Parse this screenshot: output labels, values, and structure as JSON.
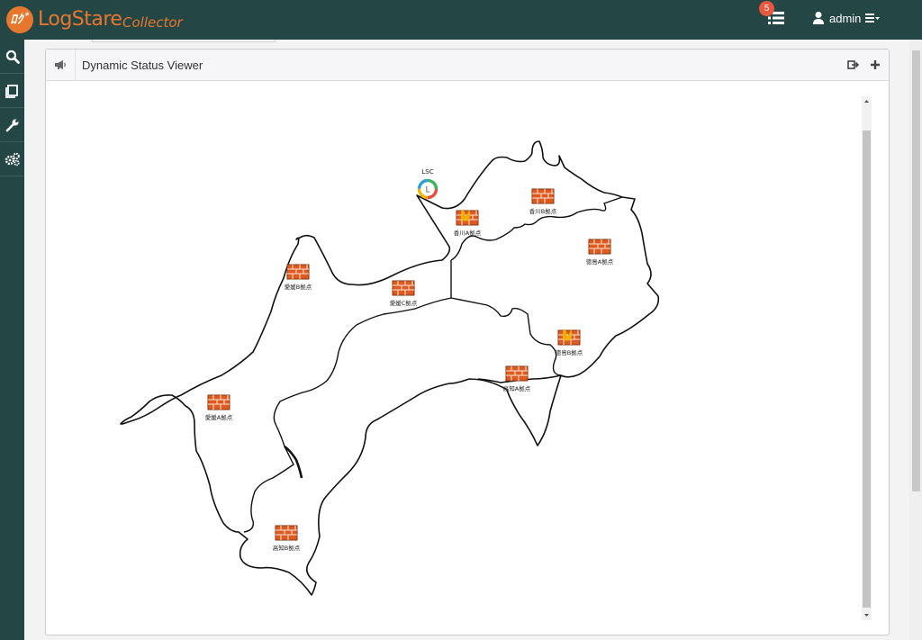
{
  "app": {
    "logo_mark": "ﾛｸﾞ",
    "name": "LogStare",
    "subtitle": "Collector",
    "notification_count": "5",
    "user": "admin"
  },
  "sidebar": {
    "items": [
      {
        "icon": "search-icon"
      },
      {
        "icon": "book-icon"
      },
      {
        "icon": "wrench-icon"
      },
      {
        "icon": "gears-icon"
      }
    ]
  },
  "panel": {
    "title": "Dynamic Status Viewer",
    "icon": "megaphone-icon",
    "actions": [
      "export-icon",
      "plus-icon"
    ]
  },
  "map": {
    "collector": {
      "label": "LSC"
    },
    "nodes": [
      {
        "id": "kagawa-a",
        "label": "香川A拠点",
        "status": "alert"
      },
      {
        "id": "kagawa-b",
        "label": "香川B拠点",
        "status": "normal"
      },
      {
        "id": "tokushima-a",
        "label": "徳島A拠点",
        "status": "normal"
      },
      {
        "id": "ehime-b",
        "label": "愛媛B拠点",
        "status": "normal"
      },
      {
        "id": "ehime-c",
        "label": "愛媛C拠点",
        "status": "normal"
      },
      {
        "id": "tokushima-b",
        "label": "徳島B拠点",
        "status": "alert"
      },
      {
        "id": "kochi-a",
        "label": "高知A拠点",
        "status": "normal"
      },
      {
        "id": "ehime-a",
        "label": "愛媛A拠点",
        "status": "normal"
      },
      {
        "id": "kochi-b",
        "label": "高知B拠点",
        "status": "normal"
      }
    ]
  },
  "colors": {
    "header": "#244645",
    "brand": "#e8772e",
    "badge": "#e8573e",
    "firewall": "#e05a1f",
    "alert": "#f4b400"
  }
}
